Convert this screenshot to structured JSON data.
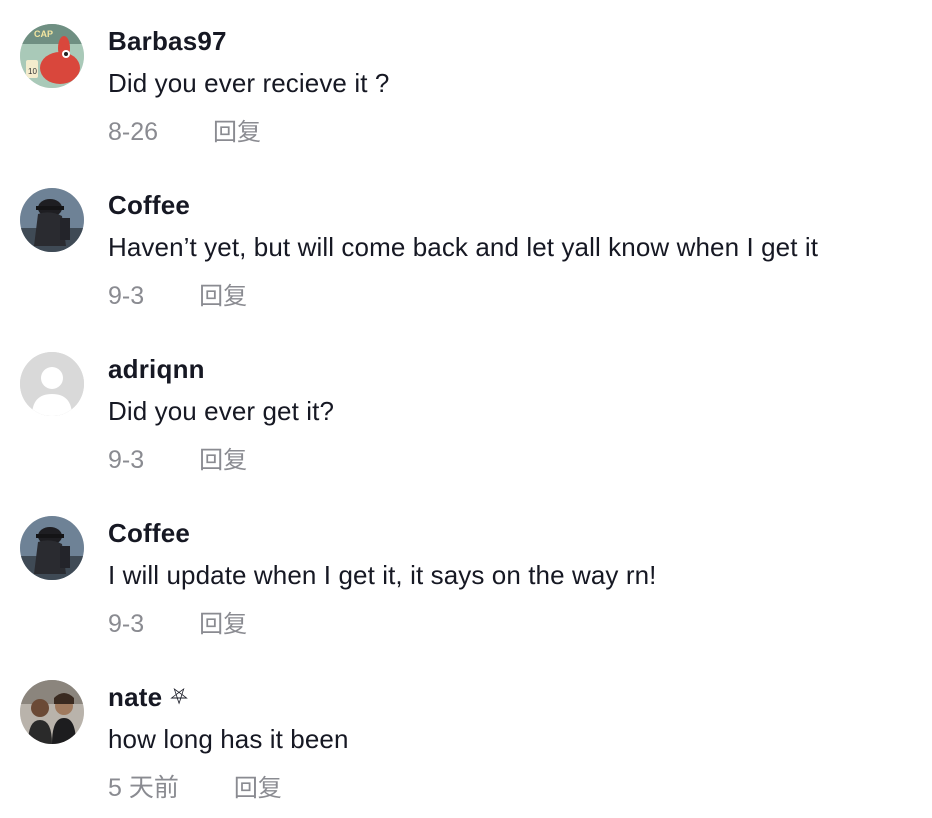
{
  "comments": [
    {
      "username": "Barbas97",
      "badge": "",
      "text": "Did you ever recieve it ?",
      "date": "8-26",
      "reply_label": "回复",
      "avatar": "crab-cartoon",
      "avatar_text": "CAP"
    },
    {
      "username": "Coffee",
      "badge": "",
      "text": "Haven’t yet, but will come back and let yall know when I get it",
      "date": "9-3",
      "reply_label": "回复",
      "avatar": "dark-figure-photo"
    },
    {
      "username": "adriqnn",
      "badge": "",
      "text": "Did you ever get it?",
      "date": "9-3",
      "reply_label": "回复",
      "avatar": "default-user"
    },
    {
      "username": "Coffee",
      "badge": "",
      "text": "I will update when I get it, it says on the way rn!",
      "date": "9-3",
      "reply_label": "回复",
      "avatar": "dark-figure-photo"
    },
    {
      "username": "nate",
      "badge": "⛧",
      "text": "how long has it been",
      "date": "5 天前",
      "reply_label": "回复",
      "avatar": "people-photo"
    }
  ],
  "colors": {
    "text": "#161823",
    "meta": "#8a8b91",
    "background": "#ffffff",
    "default_avatar_bg": "#d9d9d9"
  }
}
